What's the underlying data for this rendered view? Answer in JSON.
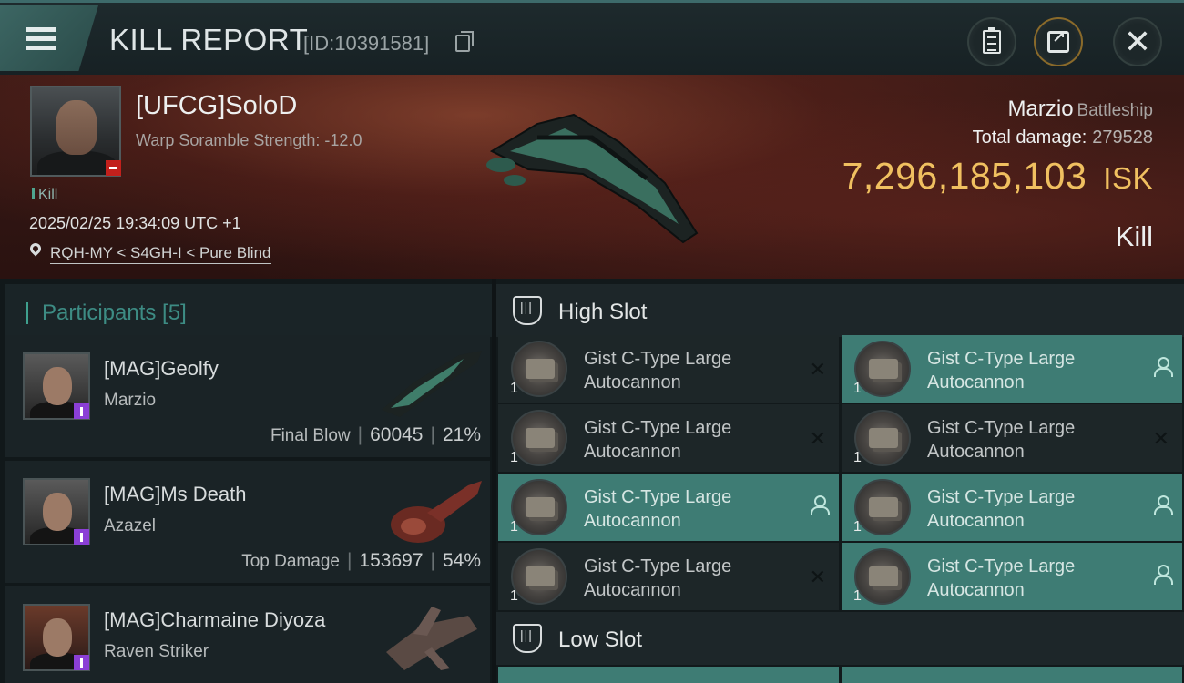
{
  "header": {
    "title": "KILL REPORT",
    "report_id": "[ID:10391581]"
  },
  "victim": {
    "name": "[UFCG]SoloD",
    "warp_scramble": "Warp Soramble Strength: -12.0",
    "tag": "Kill",
    "datetime": "2025/02/25 19:34:09 UTC +1",
    "location": "RQH-MY < S4GH-I < Pure Blind",
    "ship_name": "Marzio",
    "ship_class": "Battleship",
    "total_damage_label": "Total damage:",
    "total_damage": "279528",
    "isk_value": "7,296,185,103",
    "isk_unit": "ISK",
    "result": "Kill"
  },
  "participants": {
    "label": "Participants [5]",
    "items": [
      {
        "name": "[MAG]Geolfy",
        "ship": "Marzio",
        "role": "Final Blow",
        "damage": "60045",
        "percent": "21%"
      },
      {
        "name": "[MAG]Ms Death",
        "ship": "Azazel",
        "role": "Top Damage",
        "damage": "153697",
        "percent": "54%"
      },
      {
        "name": "[MAG]Charmaine Diyoza",
        "ship": "Raven Striker"
      }
    ]
  },
  "high_slot": {
    "label": "High Slot",
    "modules": [
      {
        "name": "Gist C-Type Large Autocannon",
        "qty": "1",
        "state": "destroyed"
      },
      {
        "name": "Gist C-Type Large Autocannon",
        "qty": "1",
        "state": "dropped"
      },
      {
        "name": "Gist C-Type Large Autocannon",
        "qty": "1",
        "state": "destroyed"
      },
      {
        "name": "Gist C-Type Large Autocannon",
        "qty": "1",
        "state": "destroyed"
      },
      {
        "name": "Gist C-Type Large Autocannon",
        "qty": "1",
        "state": "dropped"
      },
      {
        "name": "Gist C-Type Large Autocannon",
        "qty": "1",
        "state": "dropped"
      },
      {
        "name": "Gist C-Type Large Autocannon",
        "qty": "1",
        "state": "destroyed"
      },
      {
        "name": "Gist C-Type Large Autocannon",
        "qty": "1",
        "state": "dropped"
      }
    ]
  },
  "low_slot": {
    "label": "Low Slot"
  },
  "colors": {
    "accent": "#3e7c74",
    "isk": "#f0c060",
    "participants_label": "#3d8c84"
  }
}
